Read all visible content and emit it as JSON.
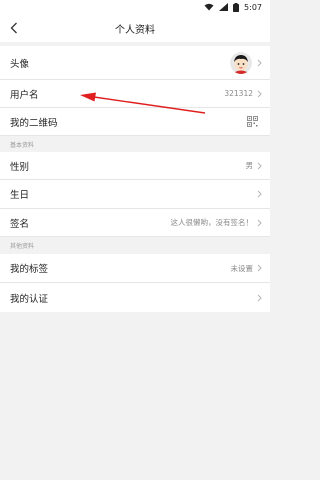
{
  "status_bar": {
    "time": "5:07",
    "icons": [
      "wifi-icon",
      "signal-icon",
      "battery-icon"
    ]
  },
  "nav": {
    "title": "个人资料",
    "back_icon": "back-icon"
  },
  "rows_main": [
    {
      "label": "头像",
      "type": "avatar"
    },
    {
      "label": "用户名",
      "value": "321312"
    },
    {
      "label": "我的二维码",
      "type": "qr"
    }
  ],
  "section_basic": "基本资料",
  "rows_basic": [
    {
      "label": "性别",
      "value": "男"
    },
    {
      "label": "生日",
      "value": ""
    },
    {
      "label": "签名",
      "value": "这人很懒哟，没有签名！"
    }
  ],
  "section_other": "其他资料",
  "rows_other": [
    {
      "label": "我的标签",
      "value": "未设置"
    },
    {
      "label": "我的认证",
      "value": ""
    }
  ],
  "colors": {
    "annotation_arrow": "#e02020",
    "background": "#f2f2f2",
    "row_bg": "#ffffff"
  }
}
